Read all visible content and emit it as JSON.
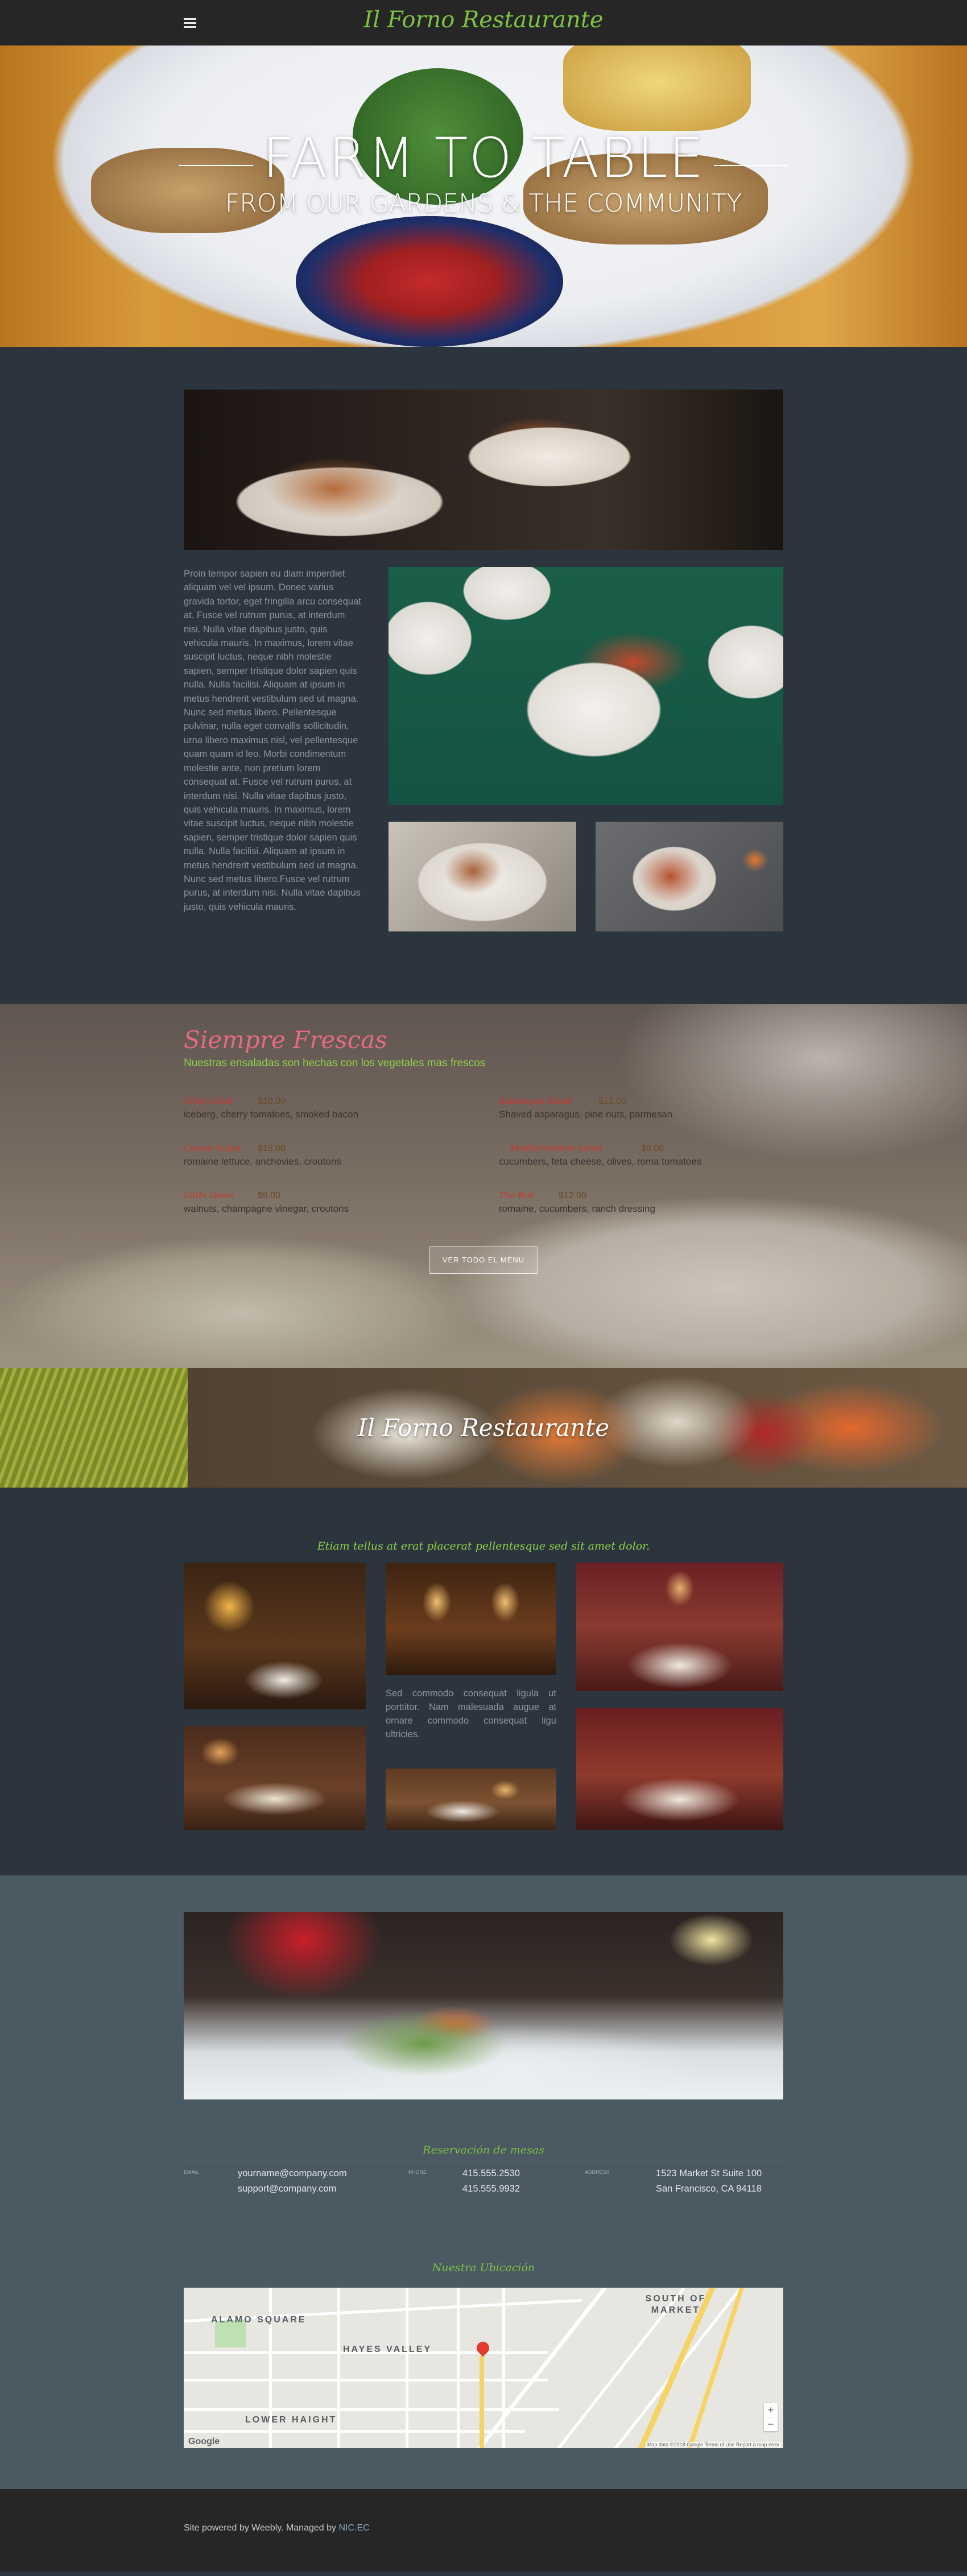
{
  "header": {
    "site_title": "Il Forno Restaurante",
    "menu_icon": "hamburger-menu-icon"
  },
  "hero": {
    "title": "FARM TO TABLE",
    "subtitle": "FROM OUR GARDENS & THE COMMUNITY"
  },
  "intro": {
    "paragraph": "Proin tempor sapien eu diam imperdiet aliquam vel vel ipsum. Donec varius gravida tortor, eget fringilla arcu consequat at. Fusce vel rutrum purus, at interdum nisi. Nulla vitae dapibus justo, quis vehicula mauris. In maximus, lorem vitae suscipit luctus, neque nibh molestie sapien, semper tristique dolor sapien quis nulla. Nulla facilisi. Aliquam at ipsum in metus hendrerit vestibulum sed ut magna. Nunc sed metus libero. Pellentesque pulvinar, nulla eget convallis sollicitudin, urna libero maximus nisl, vel pellentesque quam quam id leo. Morbi condimentum molestie ante, non pretium lorem consequat at. Fusce vel rutrum purus, at interdum nisi. Nulla vitae dapibus justo, quis vehicula mauris. In maximus, lorem vitae suscipit luctus, neque nibh molestie sapien, semper tristique dolor sapien quis nulla. Nulla facilisi. Aliquam at ipsum in metus hendrerit vestibulum sed ut magna. Nunc sed metus libero.Fusce vel rutrum purus, at interdum nisi. Nulla vitae dapibus justo, quis vehicula mauris."
  },
  "menu": {
    "title": "Siempre Frescas",
    "subtitle": "Nuestras ensaladas son hechas con los vegetales mas frescos",
    "dishes": [
      {
        "name": "Chop Salad",
        "price": "$10.00",
        "desc": "iceberg, cherry tomatoes, smoked bacon"
      },
      {
        "name": "Asparagus Salad",
        "price": "$12.00",
        "desc": "Shaved asparagus, pine nuts, parmesan"
      },
      {
        "name": "Caesar Salad",
        "price": "$15.00",
        "desc": "romaine lettuce, anchovies, croutons"
      },
      {
        "name": "Mediterranean Salad",
        "price": "$8.00",
        "desc": "cucumbers, feta cheese, olives, roma tomatoes"
      },
      {
        "name": "Little Gems",
        "price": "$9.00",
        "desc": "walnuts, champagne vinegar, croutons"
      },
      {
        "name": "The Bob",
        "price": "$12.00",
        "desc": "romaine, cucumbers, ranch dressing"
      }
    ],
    "button": "VER TODO EL MENU"
  },
  "banner": {
    "title": "Il Forno Restaurante"
  },
  "restaurant": {
    "title": "Etiam tellus at erat placerat pellentesque sed sit amet dolor.",
    "paragraph": "Sed commodo consequat ligula ut porttitor. Nam malesuada augue at ornare commodo consequat ligu ultricies."
  },
  "reservations": {
    "title": "Reservación de mesas",
    "labels": [
      "EMAIL",
      "PHONE",
      "ADDRESS"
    ],
    "emails": [
      "yourname@company.com",
      "support@company.com"
    ],
    "phones": [
      "415.555.2530",
      "415.555.9932"
    ],
    "address": [
      "1523 Market St  Suite 100",
      "San Francisco, CA 94118"
    ]
  },
  "location": {
    "title": "Nuestra Ubicación",
    "map_labels": [
      "ALAMO SQUARE",
      "HAYES VALLEY",
      "LOWER HAIGHT",
      "SOUTH OF MARKET"
    ],
    "zoom_in": "+",
    "zoom_out": "−",
    "google": "Google",
    "attribution": "Map data ©2018 Google   Terms of Use   Report a map error"
  },
  "footer": {
    "text": "Site powered by Weebly. Managed by ",
    "link": "NIC.EC"
  }
}
